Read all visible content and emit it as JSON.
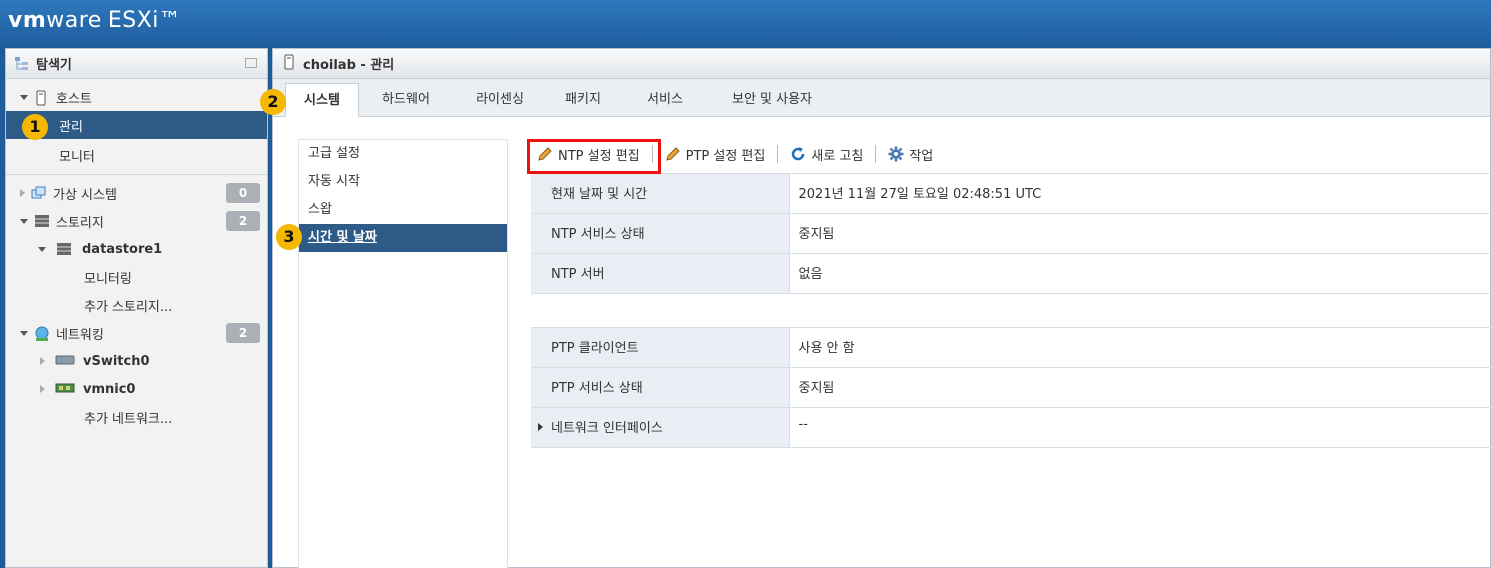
{
  "app": {
    "brand_vm": "vm",
    "brand_ware": "ware",
    "brand_product": "ESXi™"
  },
  "navigator": {
    "title": "탐색기",
    "host": {
      "label": "호스트",
      "children": [
        "관리",
        "모니터"
      ]
    },
    "vms": {
      "label": "가상 시스템",
      "count": "0"
    },
    "storage": {
      "label": "스토리지",
      "count": "2",
      "datastore": "datastore1",
      "children": [
        "모니터링",
        "추가 스토리지..."
      ]
    },
    "network": {
      "label": "네트워킹",
      "count": "2",
      "items": [
        "vSwitch0",
        "vmnic0"
      ],
      "more": "추가 네트워크..."
    }
  },
  "main": {
    "title": "choilab - 관리",
    "tabs": [
      "시스템",
      "하드웨어",
      "라이센싱",
      "패키지",
      "서비스",
      "보안 및 사용자"
    ],
    "active_tab": "시스템",
    "subnav": [
      "고급 설정",
      "자동 시작",
      "스왑",
      "시간 및 날짜"
    ],
    "active_subnav": "시간 및 날짜",
    "toolbar": {
      "ntp_edit": "NTP 설정 편집",
      "ptp_edit": "PTP 설정 편집",
      "refresh": "새로 고침",
      "actions": "작업"
    },
    "ntp_table": [
      {
        "key": "현재 날짜 및 시간",
        "value": "2021년 11월 27일 토요일 02:48:51 UTC"
      },
      {
        "key": "NTP 서비스 상태",
        "value": "중지됨"
      },
      {
        "key": "NTP 서버",
        "value": "없음"
      }
    ],
    "ptp_table": [
      {
        "key": "PTP 클라이언트",
        "value": "사용 안 함"
      },
      {
        "key": "PTP 서비스 상태",
        "value": "중지됨"
      },
      {
        "key": "네트워크 인터페이스",
        "value": "--"
      }
    ]
  },
  "annotations": [
    "1",
    "2",
    "3"
  ],
  "colors": {
    "accent": "#2d5a87",
    "highlight_box": "#e11111",
    "marker": "#f5b800",
    "topbar": "#1f5f9f"
  }
}
